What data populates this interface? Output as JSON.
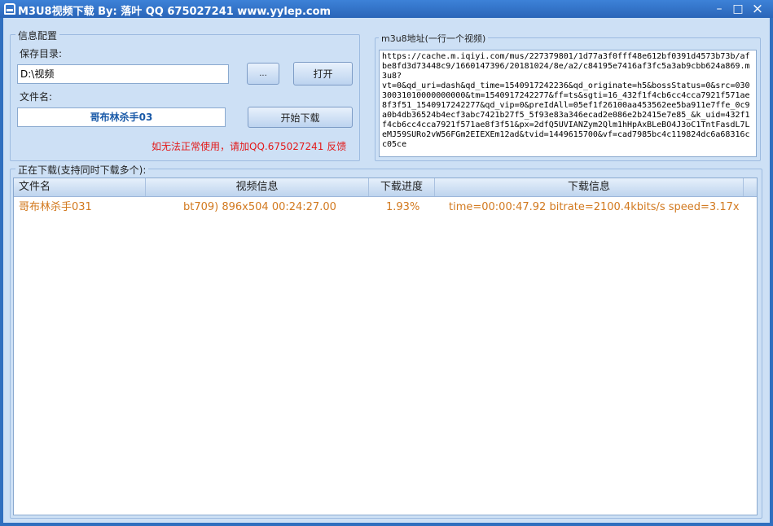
{
  "window": {
    "title": "M3U8视频下载 By: 落叶 QQ 675027241  www.yylep.com",
    "minimize_glyph": "–",
    "maximize_glyph": "□",
    "close_glyph": "×"
  },
  "config": {
    "legend": "信息配置",
    "save_dir_label": "保存目录:",
    "save_dir_value": "D:\\视频",
    "browse_label": "...",
    "open_label": "打开",
    "filename_label": "文件名:",
    "filename_value": "哥布林杀手03",
    "start_label": "开始下载",
    "warning": "如无法正常使用，请加QQ.675027241 反馈"
  },
  "m3u8": {
    "legend": "m3u8地址(一行一个视频)",
    "url": "https://cache.m.iqiyi.com/mus/227379801/1d77a3f0fff48e612bf0391d4573b73b/afbe8fd3d73448c9/1660147396/20181024/8e/a2/c84195e7416af3fc5a3ab9cbb624a869.m3u8?\nvt=0&qd_uri=dash&qd_time=1540917242236&qd_originate=h5&bossStatus=0&src=03030031010000000000&tm=1540917242277&ff=ts&sgti=16_432f1f4cb6cc4cca7921f571ae8f3f51_1540917242277&qd_vip=0&preIdAll=05ef1f26100aa453562ee5ba911e7ffe_0c9a0b4db36524b4ecf3abc7421b27f5_5f93e83a346ecad2e086e2b2415e7e85_&k_uid=432f1f4cb6cc4cca7921f571ae8f3f51&px=2dfQ5UVIANZym2Qlm1hHpAxBLeBO4J3oC1TntFasdL7LeMJ59SURo2vW56FGm2EIEXEm12ad&tvid=1449615700&vf=cad7985bc4c119824dc6a68316cc05ce"
  },
  "downloads": {
    "legend": "正在下载(支持同时下载多个):",
    "columns": [
      "文件名",
      "视频信息",
      "下载进度",
      "下载信息"
    ],
    "rows": [
      {
        "filename": "哥布林杀手031",
        "video_info": "bt709)  896x504 00:24:27.00",
        "progress": "1.93%",
        "download_info": "time=00:00:47.92 bitrate=2100.4kbits/s speed=3.17x"
      }
    ]
  },
  "colors": {
    "titlebar": "#2f6fbf",
    "client_bg": "#cde0f5",
    "warning": "#e31b1b",
    "row_text": "#d2791f",
    "filename_text": "#1a5aa8"
  }
}
